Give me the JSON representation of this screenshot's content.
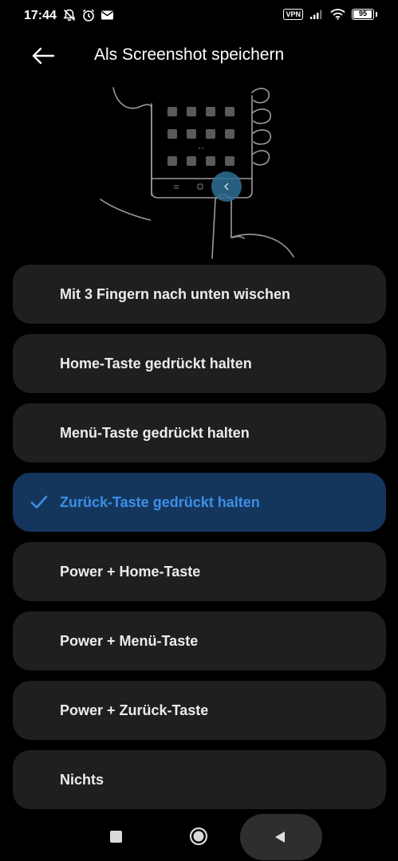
{
  "status_bar": {
    "time": "17:44",
    "vpn_label": "VPN",
    "battery_level": 95,
    "battery_text": "95"
  },
  "header": {
    "title": "Als Screenshot speichern"
  },
  "options": [
    {
      "label": "Mit 3 Fingern nach unten wischen",
      "selected": false
    },
    {
      "label": "Home-Taste gedrückt halten",
      "selected": false
    },
    {
      "label": "Menü-Taste gedrückt halten",
      "selected": false
    },
    {
      "label": "Zurück-Taste gedrückt halten",
      "selected": true
    },
    {
      "label": "Power + Home-Taste",
      "selected": false
    },
    {
      "label": "Power + Menü-Taste",
      "selected": false
    },
    {
      "label": "Power + Zurück-Taste",
      "selected": false
    },
    {
      "label": "Nichts",
      "selected": false
    }
  ],
  "colors": {
    "background": "#000000",
    "card": "#1f1f1f",
    "selected_card": "#15365c",
    "accent": "#3b8fe8"
  }
}
